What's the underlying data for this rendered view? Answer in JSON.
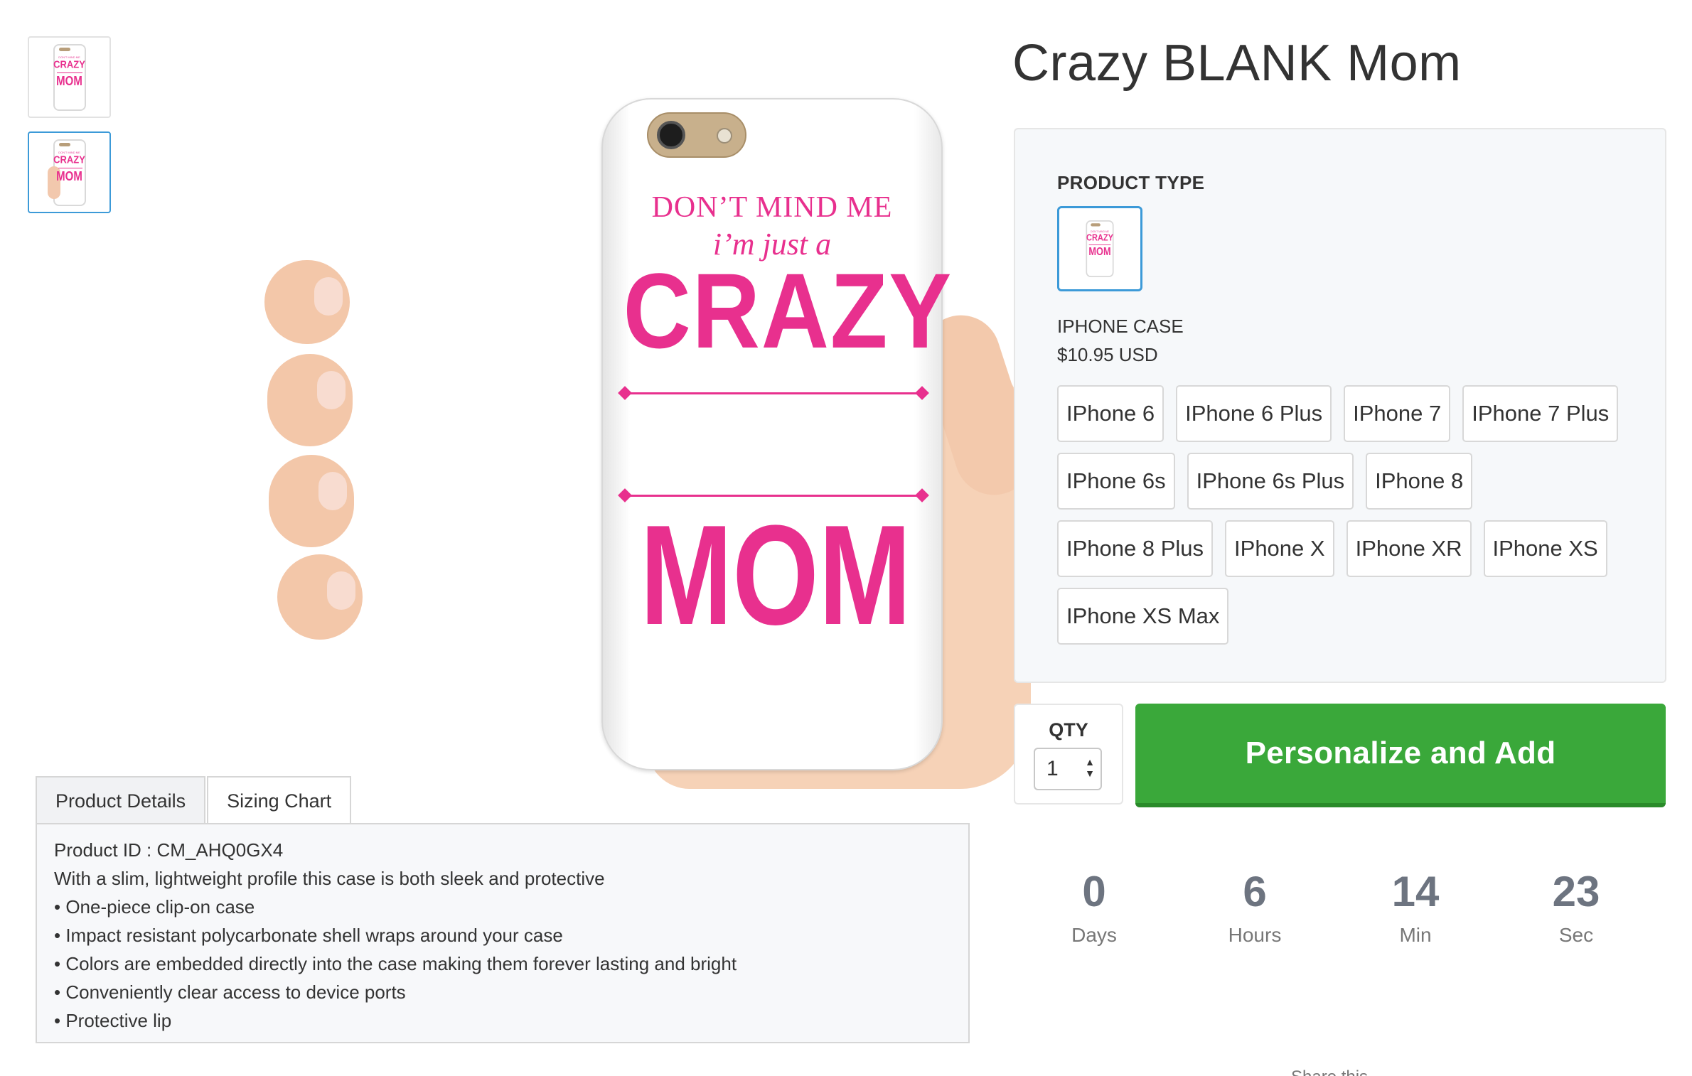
{
  "product": {
    "title": "Crazy BLANK Mom"
  },
  "gallery": {
    "thumbnails": [
      {
        "name": "thumb-case-front",
        "active": false
      },
      {
        "name": "thumb-case-in-hand",
        "active": true
      }
    ]
  },
  "case_print": {
    "line1": "DON’T MIND ME",
    "line2": "i’m just a",
    "line3": "CRAZY",
    "line4": "MOM",
    "mini_line1": "DON'T MIND ME",
    "mini_line3": "CRAZY",
    "mini_line4": "MOM"
  },
  "tabs": [
    {
      "label": "Product Details",
      "active": true
    },
    {
      "label": "Sizing Chart",
      "active": false
    }
  ],
  "details": {
    "product_id": "Product ID : CM_AHQ0GX4",
    "intro": "With a slim, lightweight profile this case is both sleek and protective",
    "bullets": [
      "• One-piece clip-on case",
      "• Impact resistant polycarbonate shell wraps around your case",
      "• Colors are embedded directly into the case making them forever lasting and bright",
      "• Conveniently clear access to device ports",
      "• Protective lip"
    ]
  },
  "product_type": {
    "label": "PRODUCT TYPE",
    "name": "IPHONE CASE",
    "price": "$10.95 USD"
  },
  "models": [
    "IPhone 6",
    "IPhone 6 Plus",
    "IPhone 7",
    "IPhone 7 Plus",
    "IPhone 6s",
    "IPhone 6s Plus",
    "IPhone 8",
    "IPhone 8 Plus",
    "IPhone X",
    "IPhone XR",
    "IPhone XS",
    "IPhone XS Max"
  ],
  "qty": {
    "label": "QTY",
    "value": "1",
    "arrows": "▲▼"
  },
  "cta": {
    "label": "Personalize and Add"
  },
  "countdown": [
    {
      "value": "0",
      "label": "Days"
    },
    {
      "value": "6",
      "label": "Hours"
    },
    {
      "value": "14",
      "label": "Min"
    },
    {
      "value": "23",
      "label": "Sec"
    }
  ],
  "share": {
    "label": "Share this"
  },
  "colors": {
    "accent_blue": "#3c9ad8",
    "cta_green": "#3aa83a",
    "print_pink": "#e8308e"
  }
}
